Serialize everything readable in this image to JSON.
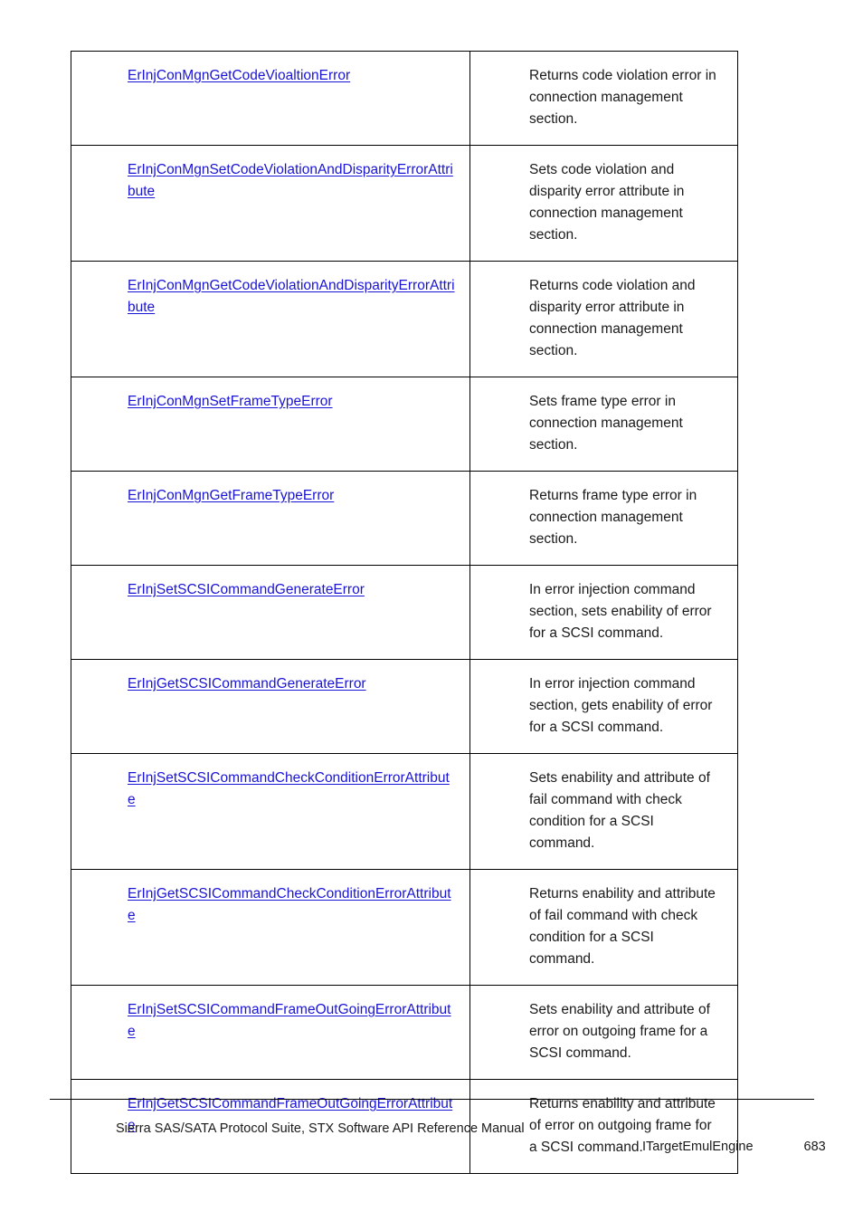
{
  "document": {
    "page_number": "683",
    "chapter": "ITargetEmulEngine",
    "footer_title": "Sierra SAS/SATA Protocol Suite, STX Software API Reference Manual"
  },
  "table": {
    "rows": [
      {
        "name": "ErInjConMgnGetCodeVioaltionError",
        "description": "Returns code violation error in connection management section."
      },
      {
        "name": "ErInjConMgnSetCodeViolationAndDisparityErrorAttribute",
        "description": "Sets code violation and disparity error attribute in connection management section."
      },
      {
        "name": "ErInjConMgnGetCodeViolationAndDisparityErrorAttribute",
        "description": "Returns code violation and disparity error attribute in connection management section."
      },
      {
        "name": "ErInjConMgnSetFrameTypeError",
        "description": "Sets frame type error in connection management section."
      },
      {
        "name": "ErInjConMgnGetFrameTypeError",
        "description": "Returns frame type error in connection management section."
      },
      {
        "name": "ErInjSetSCSICommandGenerateError",
        "description": "In error injection command section, sets enability of error for a SCSI command."
      },
      {
        "name": "ErInjGetSCSICommandGenerateError",
        "description": "In error injection command section, gets enability of error for a SCSI command."
      },
      {
        "name": "ErInjSetSCSICommandCheckConditionErrorAttribute",
        "description": "Sets enability and attribute of fail command with check condition for a SCSI command."
      },
      {
        "name": "ErInjGetSCSICommandCheckConditionErrorAttribute",
        "description": "Returns enability and attribute of fail command with check condition for a SCSI command."
      },
      {
        "name": "ErInjSetSCSICommandFrameOutGoingErrorAttribute",
        "description": "Sets enability and attribute of error on outgoing frame for a SCSI command."
      },
      {
        "name": "ErInjGetSCSICommandFrameOutGoingErrorAttribute",
        "description": "Returns enability and attribute of error on outgoing frame for a SCSI command."
      }
    ]
  },
  "colors": {
    "link": "#1a14d6",
    "text": "#1a1a1a",
    "border": "#000000"
  }
}
